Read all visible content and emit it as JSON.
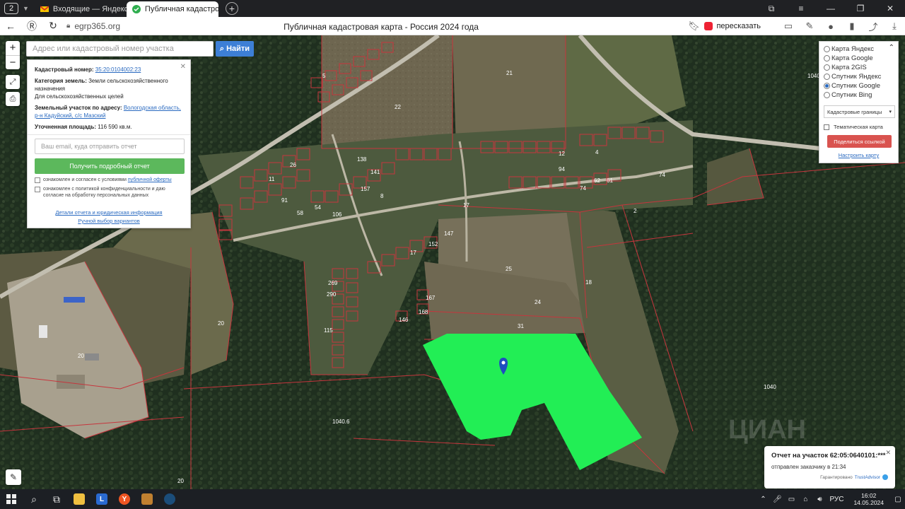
{
  "browser": {
    "tab_count": "2",
    "tabs": [
      {
        "title": "Входящие — Яндекс Почта",
        "active": false
      },
      {
        "title": "Публичная кадастровая карта",
        "active": true
      }
    ],
    "url": "egrp365.org",
    "page_title": "Публичная кадастровая карта - Россия 2024 года",
    "retell_label": "пересказать"
  },
  "map": {
    "search_placeholder": "Адрес или кадастровый номер участка",
    "search_button": "Найти",
    "zoom_in": "+",
    "zoom_out": "−",
    "parcel_labels": [
      "21",
      "22",
      "25",
      "18",
      "24",
      "31",
      "20",
      "20",
      "20",
      "2",
      "17",
      "74",
      "1040",
      "1040",
      "1040.6",
      "115",
      "290",
      "269",
      "146",
      "168",
      "167",
      "152",
      "147",
      "74",
      "94",
      "12",
      "4",
      "61",
      "62",
      "138",
      "141",
      "157",
      "8",
      "54",
      "106",
      "58",
      "91",
      "11",
      "26",
      "17",
      "5"
    ],
    "parcel_color": "#22ee55"
  },
  "info_panel": {
    "cadastral_label": "Кадастровый номер:",
    "cadastral_value": "35:20:0104002:23",
    "category_label": "Категория земель:",
    "category_value": "Земли сельскохозяйственного назначения",
    "use_value": "Для сельскохозяйственных целей",
    "address_label": "Земельный участок по адресу:",
    "address_value": "Вологодская область, р-н Кадуйский, с/с Мазский",
    "area_label": "Уточненная площадь:",
    "area_value": "116 590 кв.м.",
    "email_placeholder": "Ваш email, куда отправить отчет",
    "report_button": "Получить подробный отчет",
    "consent1_text": "ознакомлен и согласен с условиями",
    "consent1_link": "публичной оферты",
    "consent2_text": "ознакомлен с политикой конфиденциальности и даю согласие на обработку персональных данных",
    "details_link": "Детали отчета и юридическая информация",
    "manual_link": "Ручной выбор вариантов"
  },
  "layers": {
    "options": [
      {
        "label": "Карта Яндекс",
        "checked": false
      },
      {
        "label": "Карта Google",
        "checked": false
      },
      {
        "label": "Карта 2GIS",
        "checked": false
      },
      {
        "label": "Спутник Яндекс",
        "checked": false
      },
      {
        "label": "Спутник Google",
        "checked": true
      },
      {
        "label": "Спутник Bing",
        "checked": false
      }
    ],
    "boundaries_select": "Кадастровые границы",
    "thematic_label": "Тематическая карта",
    "share_button": "Поделиться ссылкой",
    "setup_link": "Настроить карту"
  },
  "notification": {
    "title": "Отчет на участок 62:05:0640101:***",
    "body": "отправлен заказчику в 21:34",
    "footer": "Гарантировано",
    "verify": "TrustAdvisor"
  },
  "taskbar": {
    "lang": "РУС",
    "time": "16:02",
    "date": "14.05.2024"
  },
  "watermark": "ЦИАН"
}
